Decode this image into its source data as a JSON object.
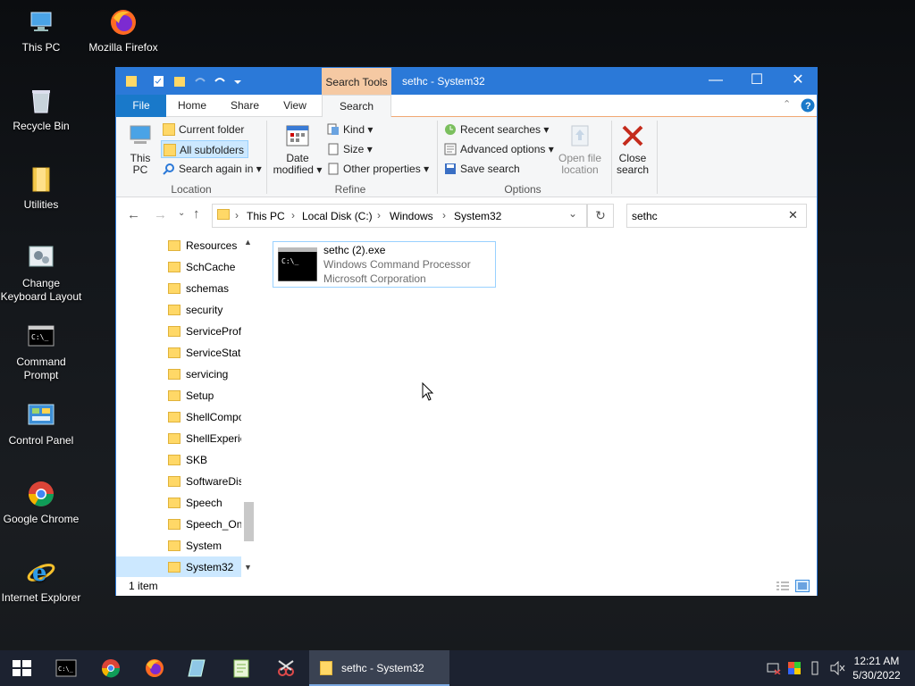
{
  "desktop": {
    "icons": [
      {
        "label": "This PC",
        "icon": "this-pc-icon"
      },
      {
        "label": "Mozilla Firefox",
        "icon": "firefox-icon"
      },
      {
        "label": "Recycle Bin",
        "icon": "recycle-bin-icon"
      },
      {
        "label": "Utilities",
        "icon": "folder-icon"
      },
      {
        "label": "Change Keyboard Layout",
        "icon": "keyboard-settings-icon"
      },
      {
        "label": "Command Prompt",
        "icon": "command-prompt-icon"
      },
      {
        "label": "Control Panel",
        "icon": "control-panel-icon"
      },
      {
        "label": "Google Chrome",
        "icon": "chrome-icon"
      },
      {
        "label": "Internet Explorer",
        "icon": "internet-explorer-icon"
      }
    ]
  },
  "window": {
    "title": "sethc - System32",
    "context_tab": "Search Tools",
    "tabs": {
      "file": "File",
      "home": "Home",
      "share": "Share",
      "view": "View",
      "search": "Search"
    },
    "ribbon": {
      "location": {
        "this_pc_line1": "This",
        "this_pc_line2": "PC",
        "current_folder": "Current folder",
        "all_subfolders": "All subfolders",
        "search_again_in": "Search again in",
        "group_label": "Location"
      },
      "refine": {
        "date_modified_line1": "Date",
        "date_modified_line2": "modified",
        "kind": "Kind",
        "size": "Size",
        "other_properties": "Other properties",
        "group_label": "Refine"
      },
      "options": {
        "recent_searches": "Recent searches",
        "advanced_options": "Advanced options",
        "save_search": "Save search",
        "open_file_location_line1": "Open file",
        "open_file_location_line2": "location",
        "group_label": "Options"
      },
      "close_search_line1": "Close",
      "close_search_line2": "search"
    },
    "address": {
      "breadcrumb": [
        "This PC",
        "Local Disk (C:)",
        "Windows",
        "System32"
      ]
    },
    "search": {
      "value": "sethc"
    },
    "nav_items": [
      "Resources",
      "SchCache",
      "schemas",
      "security",
      "ServiceProfi",
      "ServiceState",
      "servicing",
      "Setup",
      "ShellCompo",
      "ShellExperie",
      "SKB",
      "SoftwareDis",
      "Speech",
      "Speech_One",
      "System",
      "System32"
    ],
    "selected_nav": "System32",
    "result": {
      "name": "sethc (2).exe",
      "description": "Windows Command Processor",
      "company": "Microsoft Corporation"
    },
    "status": "1 item"
  },
  "taskbar": {
    "active_window": "sethc - System32",
    "clock_time": "12:21 AM",
    "clock_date": "5/30/2022"
  },
  "colors": {
    "title_blue": "#2b79d8",
    "search_tools_accent": "#f5c9a3",
    "file_tab_blue": "#1979ca",
    "selection": "#cce8ff",
    "close_red": "#c42b1c"
  }
}
